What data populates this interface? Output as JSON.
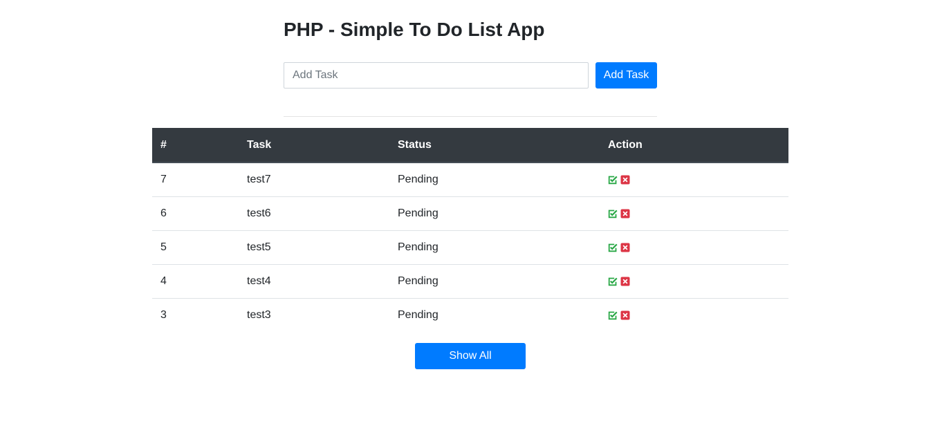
{
  "app": {
    "title": "PHP - Simple To Do List App"
  },
  "add_form": {
    "input_value": "",
    "input_placeholder": "Add Task",
    "add_button_label": "Add Task"
  },
  "table": {
    "headers": {
      "id": "#",
      "task": "Task",
      "status": "Status",
      "action": "Action"
    },
    "rows": [
      {
        "id": "7",
        "task": "test7",
        "status": "Pending"
      },
      {
        "id": "6",
        "task": "test6",
        "status": "Pending"
      },
      {
        "id": "5",
        "task": "test5",
        "status": "Pending"
      },
      {
        "id": "4",
        "task": "test4",
        "status": "Pending"
      },
      {
        "id": "3",
        "task": "test3",
        "status": "Pending"
      }
    ],
    "action_icons": {
      "complete": "check-square-icon",
      "delete": "close-square-icon"
    }
  },
  "footer": {
    "show_all_label": "Show All"
  },
  "colors": {
    "primary": "#007bff",
    "table_header_bg": "#343a40",
    "success": "#28a745",
    "danger": "#dc3545"
  }
}
